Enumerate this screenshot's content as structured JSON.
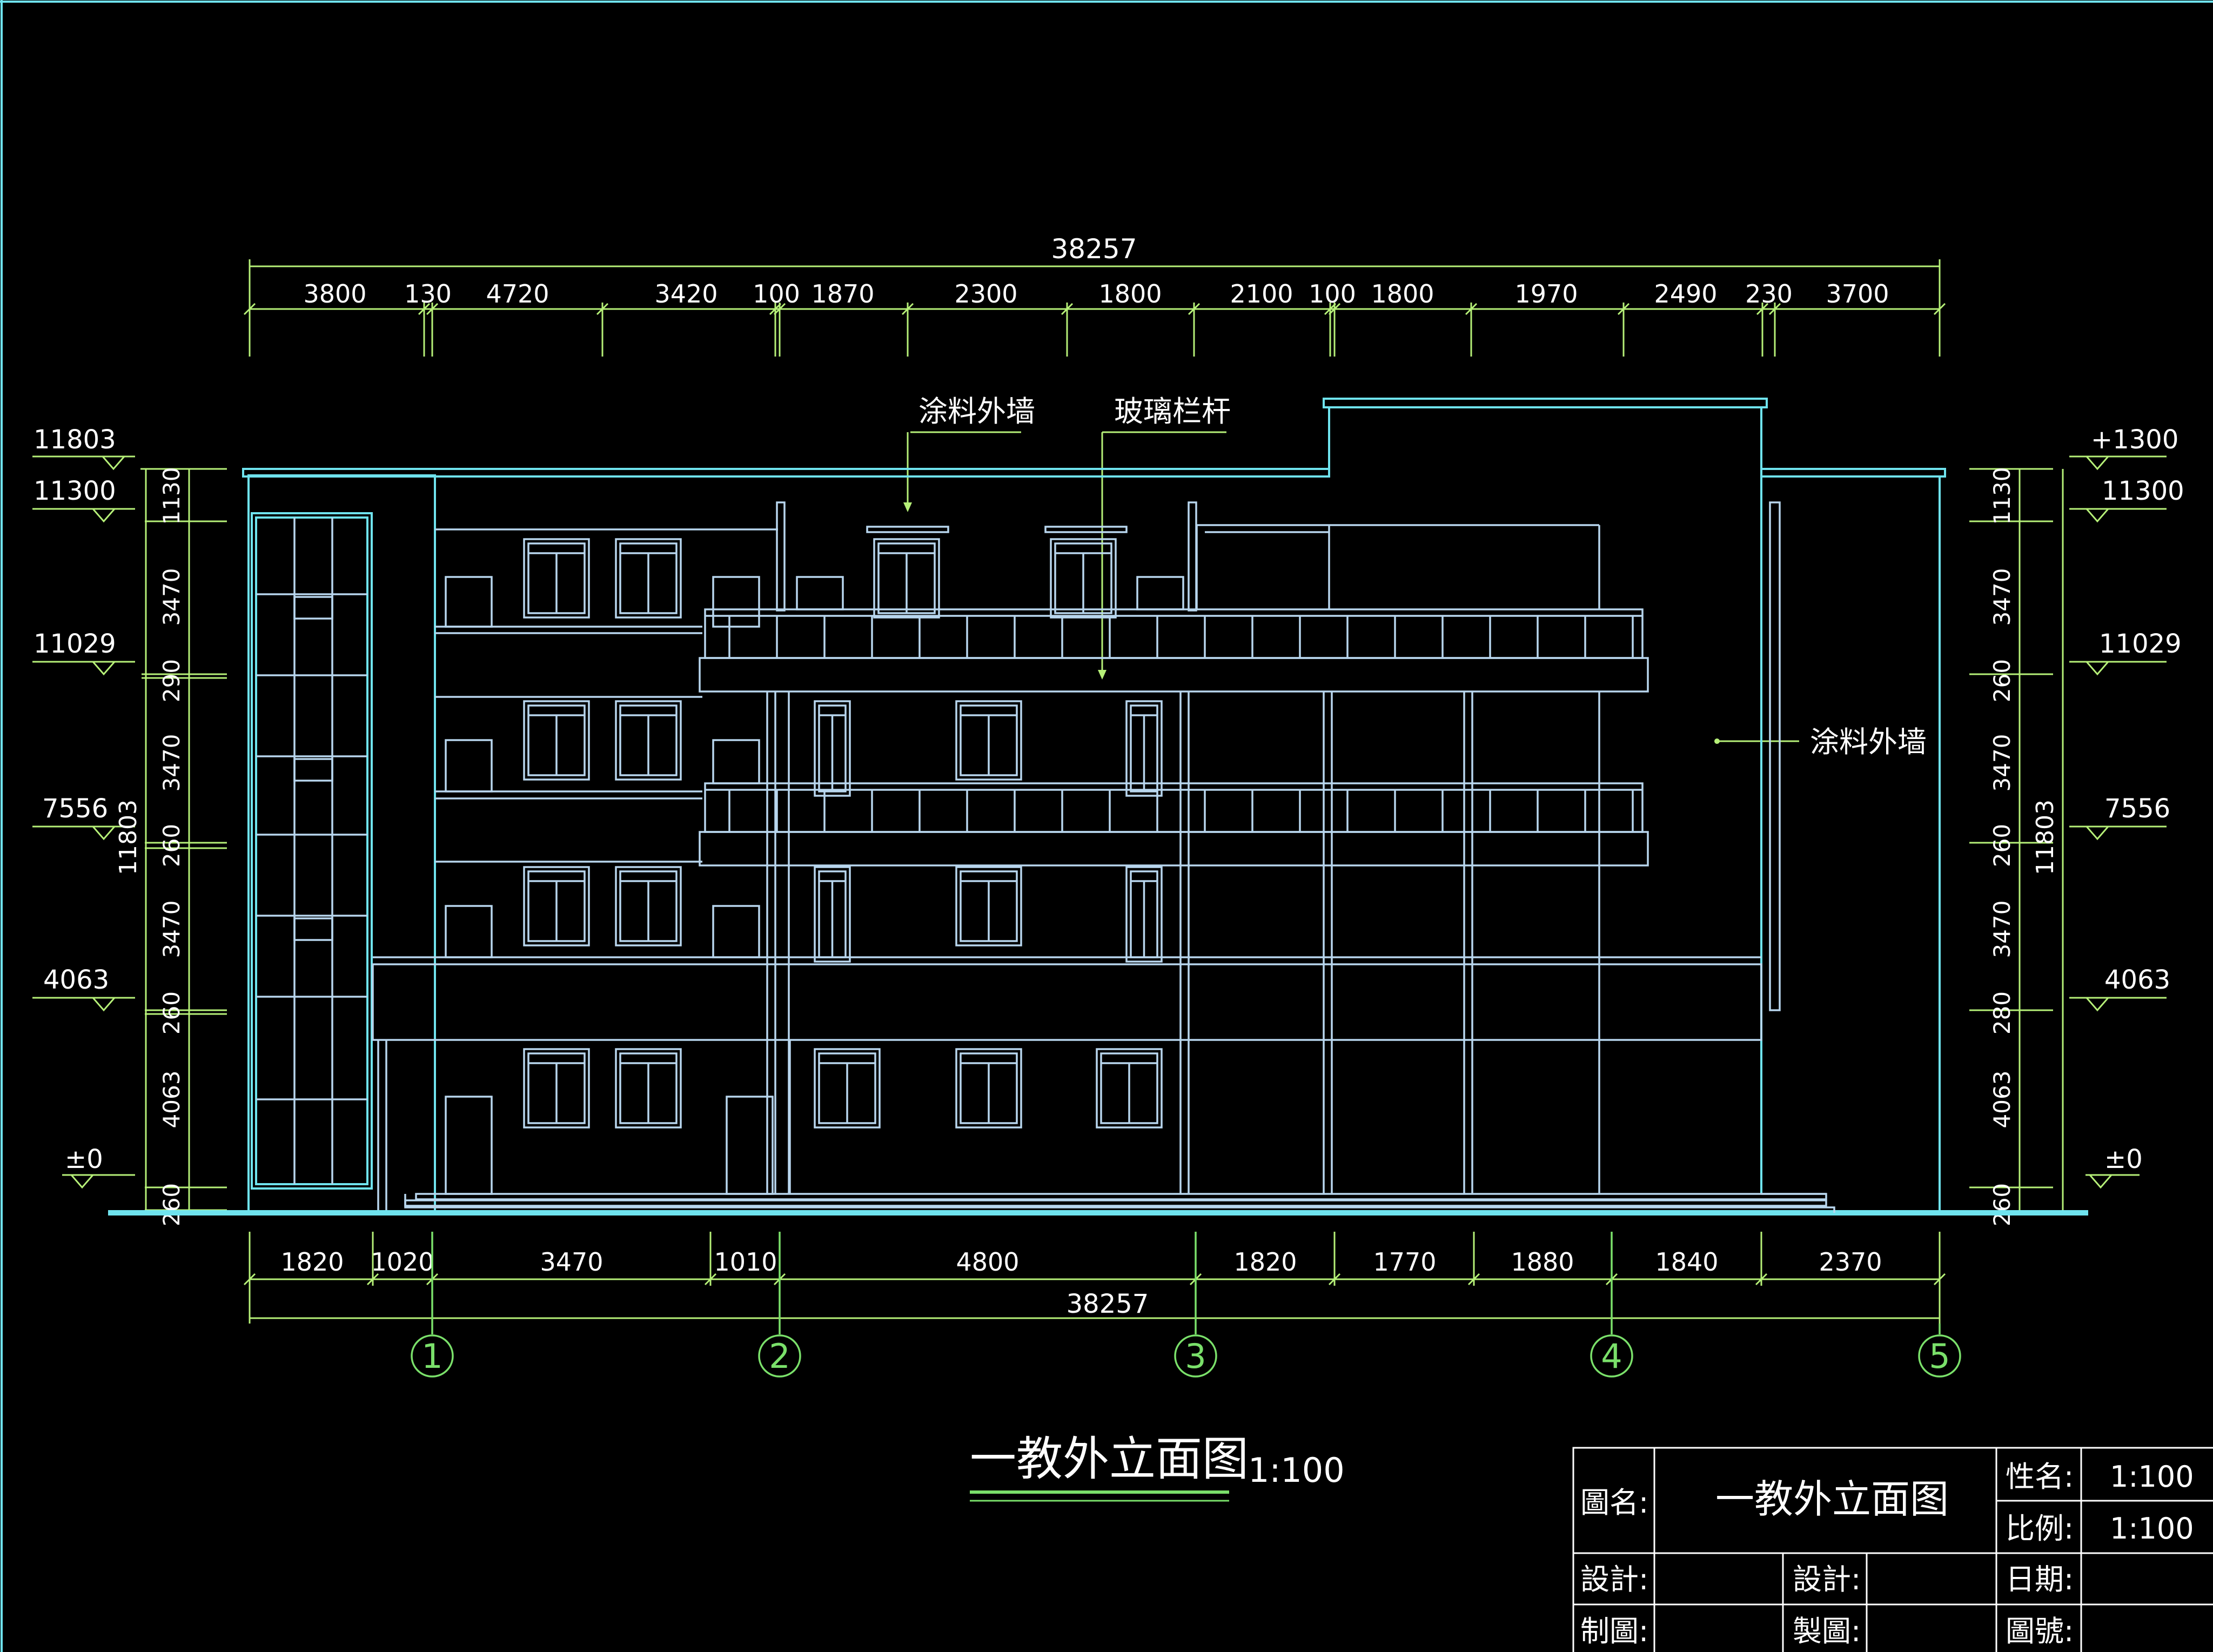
{
  "drawing": {
    "title": "一教外立面图",
    "scale": "1:100",
    "top_total": "38257",
    "top_segments": [
      "3800",
      "130",
      "4720",
      "3420",
      "100",
      "1870",
      "2300",
      "1800",
      "2100",
      "100",
      "1800",
      "1970",
      "2490",
      "230",
      "3700"
    ],
    "bottom_segments": [
      "1820",
      "1020",
      "3470",
      "1010",
      "4800",
      "1820",
      "1770",
      "1880",
      "1840",
      "2370"
    ],
    "bottom_total": "38257",
    "axes": [
      "1",
      "2",
      "3",
      "4",
      "5"
    ],
    "left_levels": [
      "11803",
      "11300",
      "11029",
      "7556",
      "4063",
      "±0"
    ],
    "right_levels": [
      "+1300",
      "11300",
      "11029",
      "7556",
      "4063",
      "±0"
    ],
    "vertical_segments": [
      "1130",
      "3470",
      "290",
      "3470",
      "260",
      "3470",
      "260",
      "4063",
      "260"
    ],
    "right_vertical_segments": [
      "1130",
      "3470",
      "260",
      "3470",
      "260",
      "3470",
      "280",
      "4063",
      "260"
    ],
    "vertical_total": "11803",
    "annotations": {
      "wall_coating": "涂料外墙",
      "glass_railing": "玻璃栏杆",
      "wall_coating_right": "涂料外墙"
    }
  },
  "title_block": {
    "drawing_name_label": "圖名:",
    "drawing_name": "一教外立面图",
    "name_label": "性名:",
    "name_value": "1:100",
    "scale_label": "比例:",
    "scale_value": "1:100",
    "design_label": "設計:",
    "design_label_2": "設計:",
    "date_label": "日期:",
    "drafting_label": "制圖:",
    "drafting_label_2": "製圖:",
    "drawing_no_label": "圖號:"
  }
}
